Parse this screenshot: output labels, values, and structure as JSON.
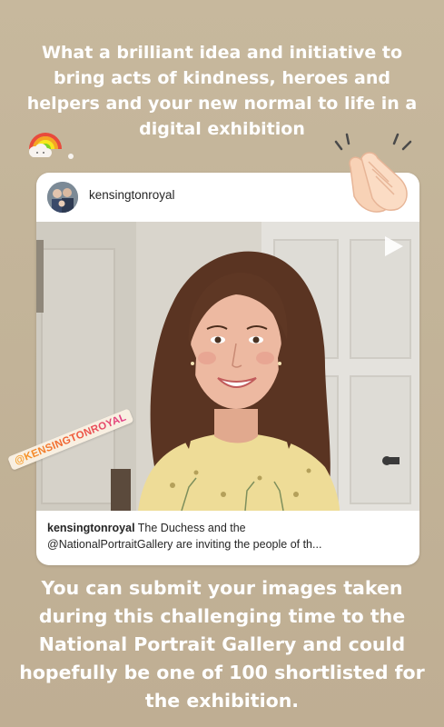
{
  "story": {
    "top_text": "What a brilliant idea and initiative to bring acts of kindness, heroes and helpers and your new normal to life in a digital exhibition",
    "bottom_text": "You can submit your images taken during this challenging time to the National Portrait Gallery and could hopefully be one of 100 shortlisted for the exhibition."
  },
  "post": {
    "username": "kensingtonroyal",
    "caption_username": "kensingtonroyal",
    "caption_line1": " The Duchess and the",
    "caption_line2": "@NationalPortraitGallery are inviting the people of th..."
  },
  "stickers": {
    "mention": "@KENSINGTONROYAL",
    "rainbow": "rainbow-cloud-sticker",
    "clap": "clapping-hands-sticker"
  },
  "colors": {
    "background": "#c4b59a",
    "text": "#ffffff",
    "card": "#ffffff"
  }
}
